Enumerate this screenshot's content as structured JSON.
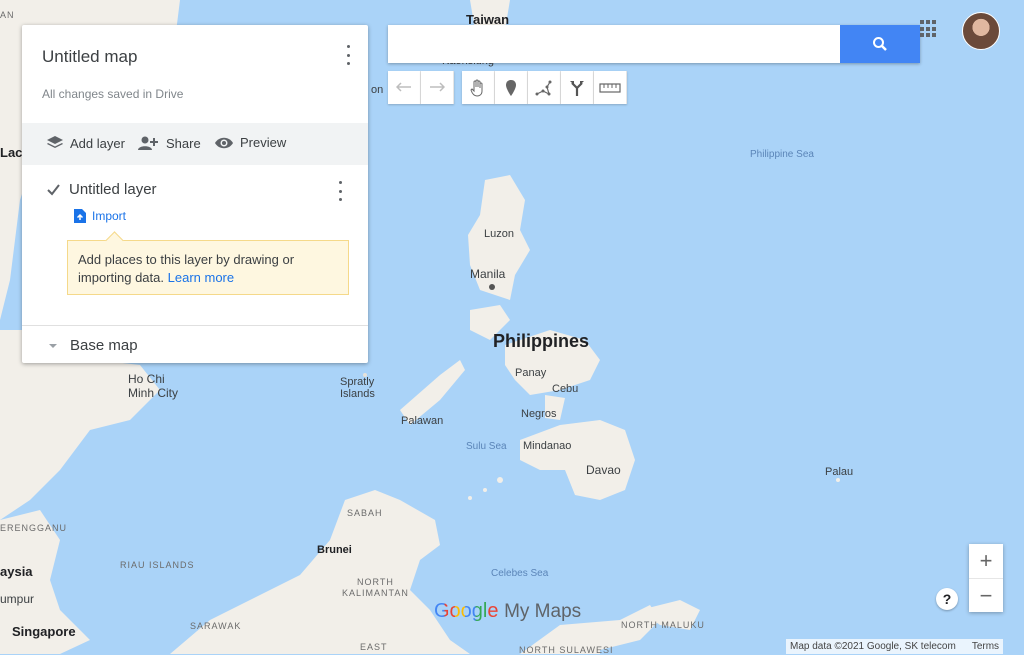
{
  "map": {
    "labels": {
      "taiwan": "Taiwan",
      "kaohsiung": "Kaohsiung",
      "philippine_sea": "Philippine Sea",
      "luzon": "Luzon",
      "manila": "Manila",
      "philippines": "Philippines",
      "panay": "Panay",
      "cebu": "Cebu",
      "negros": "Negros",
      "spratly": "Spratly\nIslands",
      "palawan": "Palawan",
      "sulu_sea": "Sulu Sea",
      "mindanao": "Mindanao",
      "davao": "Davao",
      "palau": "Palau",
      "ho_chi_minh": "Ho Chi\nMinh City",
      "sabah": "SABAH",
      "brunei": "Brunei",
      "north_kalimantan": "NORTH\nKALIMANTAN",
      "riau": "RIAU ISLANDS",
      "celebes": "Celebes Sea",
      "sarawak": "SARAWAK",
      "east": "EAST",
      "north_sulawesi": "NORTH SULAWESI",
      "north_maluku": "NORTH MALUKU",
      "singapore": "Singapore",
      "terengganu": "ERENGGANU",
      "aysia": "aysia",
      "umpur": "umpur",
      "lac": "Lac",
      "an": "AN",
      "on_frag": "on"
    }
  },
  "panel": {
    "title": "Untitled map",
    "status": "All changes saved in Drive",
    "actions": {
      "add_layer": "Add layer",
      "share": "Share",
      "preview": "Preview"
    },
    "layer": {
      "name": "Untitled layer",
      "import": "Import",
      "tip_text": "Add places to this layer by drawing or importing data.",
      "tip_link": "Learn more"
    },
    "basemap": "Base map"
  },
  "search": {
    "value": "",
    "placeholder": ""
  },
  "toolbar": {
    "icons": [
      "undo-icon",
      "redo-icon",
      "hand-icon",
      "marker-icon",
      "line-icon",
      "directions-icon",
      "ruler-icon"
    ]
  },
  "zoom": {
    "in": "+",
    "out": "−"
  },
  "help": "?",
  "attribution": {
    "data": "Map data ©2021 Google, SK telecom",
    "terms": "Terms"
  },
  "logo": {
    "google": "Google",
    "product": "My Maps"
  },
  "colors": {
    "water": "#aad3f8",
    "land": "#f2efe9",
    "accent": "#4285f4",
    "arrow": "#e30000"
  }
}
